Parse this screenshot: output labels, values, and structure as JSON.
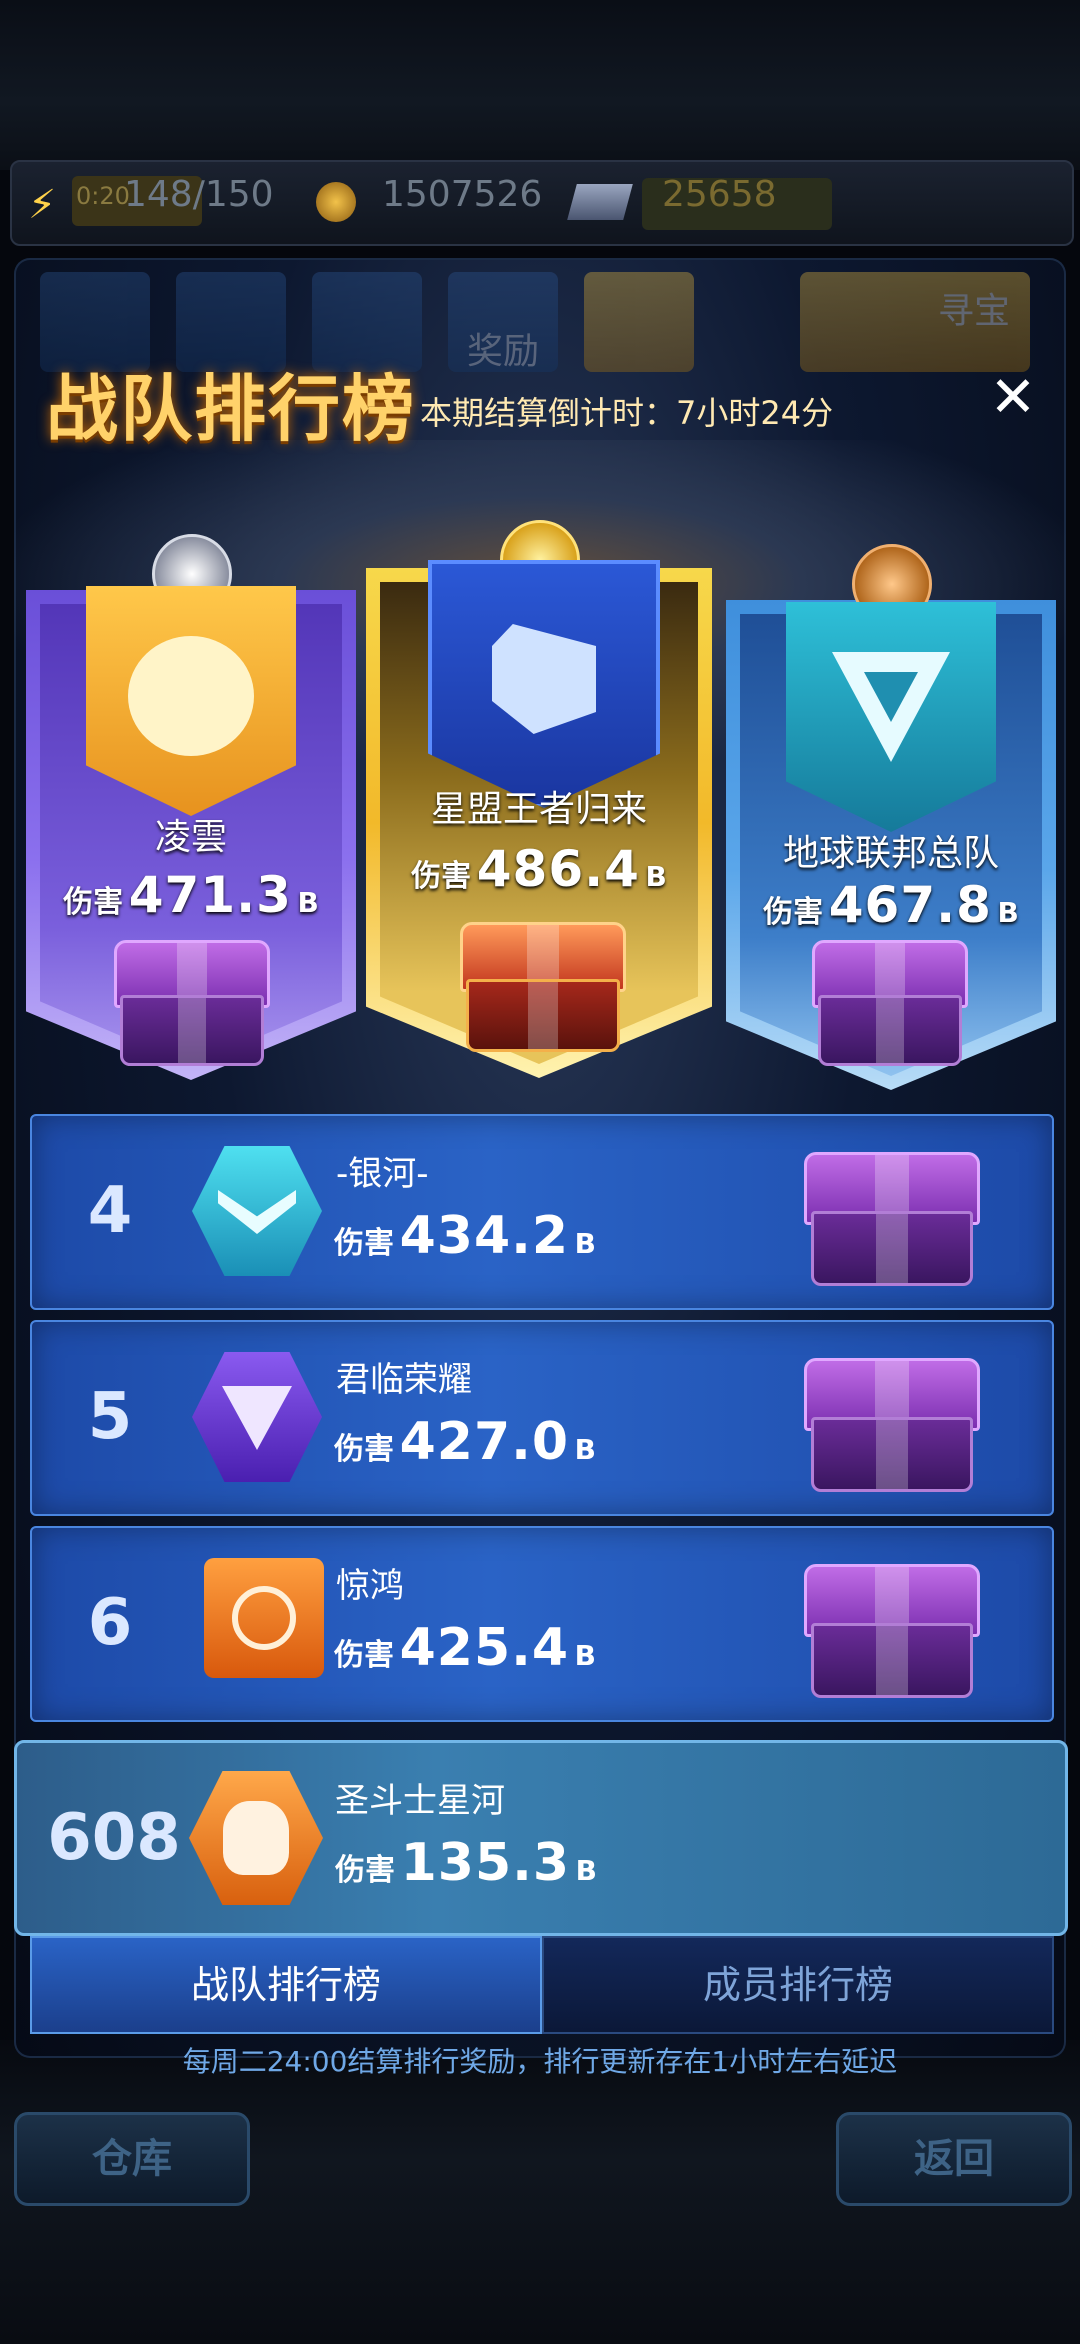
{
  "resources": {
    "energy_timer": "0:20",
    "energy": "148/150",
    "gold": "1507526",
    "gems": "25658"
  },
  "nav_tabs": [
    "奖励",
    "寻宝"
  ],
  "title": "战队排行榜",
  "countdown": "本期结算倒计时：7小时24分",
  "damage_label": "伤害",
  "unit": "B",
  "podium": [
    {
      "rank": 2,
      "name": "凌雲",
      "damage": "471.3"
    },
    {
      "rank": 1,
      "name": "星盟王者归来",
      "damage": "486.4"
    },
    {
      "rank": 3,
      "name": "地球联邦总队",
      "damage": "467.8"
    }
  ],
  "ranks": [
    {
      "rank": "4",
      "name": "-银河-",
      "damage": "434.2"
    },
    {
      "rank": "5",
      "name": "君临荣耀",
      "damage": "427.0"
    },
    {
      "rank": "6",
      "name": "惊鸿",
      "damage": "425.4"
    }
  ],
  "my_team": {
    "rank": "608",
    "name": "圣斗士星河",
    "damage": "135.3"
  },
  "tabs": {
    "team": "战队排行榜",
    "member": "成员排行榜"
  },
  "notice": "每周二24:00结算排行奖励，排行更新存在1小时左右延迟",
  "bottom_buttons": {
    "warehouse": "仓库",
    "back": "返回"
  },
  "colors": {
    "gold_title": "#ffd26a",
    "row_blue": "#2a63c6",
    "notice": "#6fa8e6"
  }
}
